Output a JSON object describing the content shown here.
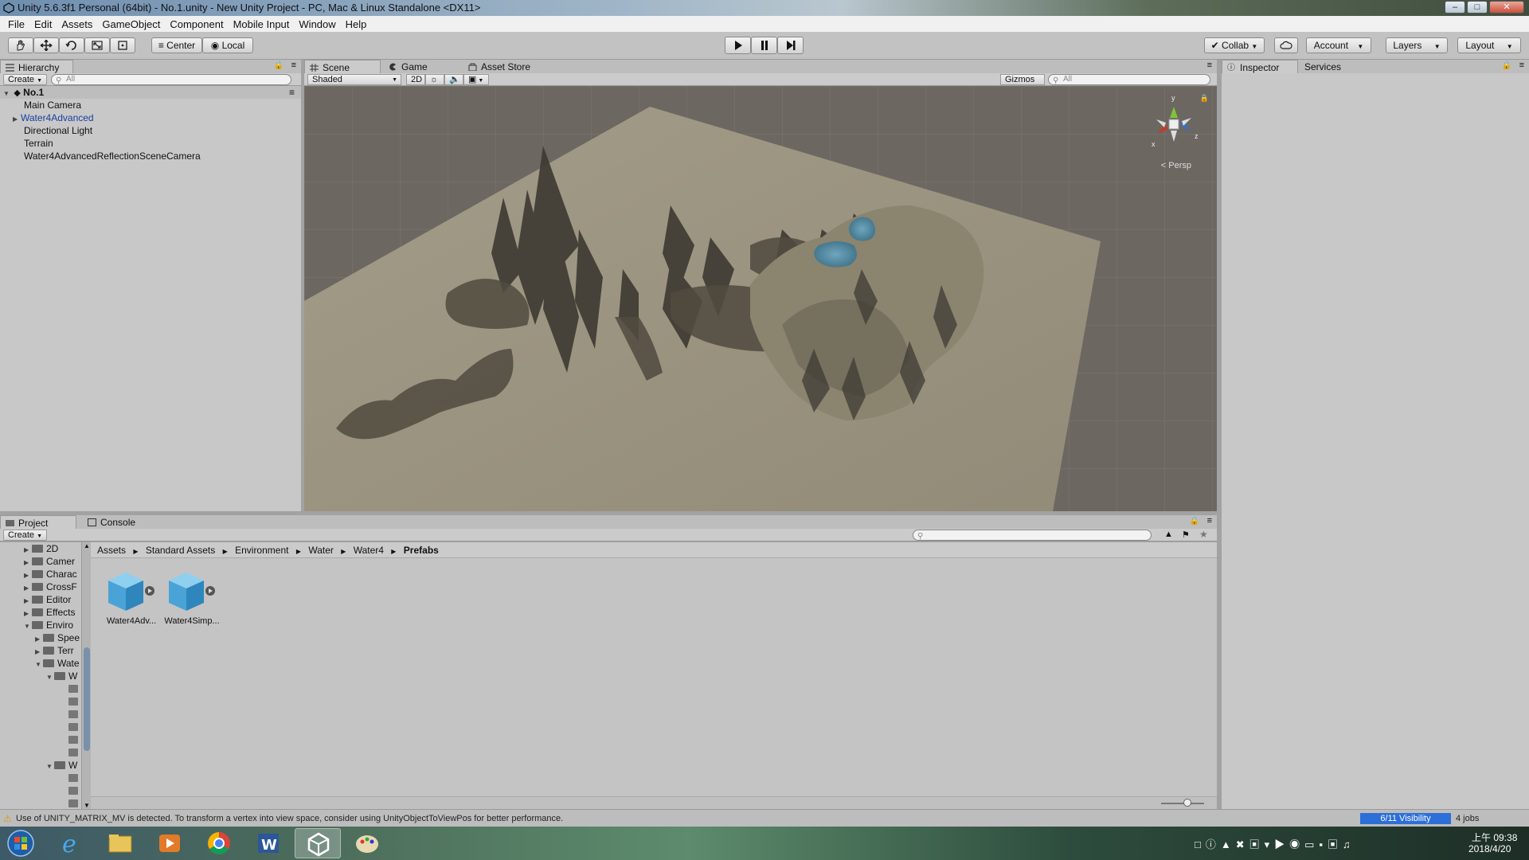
{
  "window": {
    "title": "Unity 5.6.3f1 Personal (64bit) - No.1.unity - New Unity Project - PC, Mac & Linux Standalone <DX11>",
    "controls": [
      "minimize-icon",
      "maximize-icon",
      "close-icon"
    ]
  },
  "menu": [
    "File",
    "Edit",
    "Assets",
    "GameObject",
    "Component",
    "Mobile Input",
    "Window",
    "Help"
  ],
  "toolbar": {
    "tools": [
      "hand-icon",
      "move-icon",
      "rotate-icon",
      "scale-icon",
      "rect-icon"
    ],
    "pivot_label": "Center",
    "space_label": "Local",
    "play_controls": [
      "play-icon",
      "pause-icon",
      "step-icon"
    ],
    "collab_label": "Collab",
    "account_label": "Account",
    "layers_label": "Layers",
    "layout_label": "Layout"
  },
  "hierarchy": {
    "tab": "Hierarchy",
    "create_label": "Create",
    "search_placeholder": "All",
    "scene_name": "No.1",
    "items": [
      {
        "label": "Main Camera"
      },
      {
        "label": "Water4Advanced",
        "color": "#1a3fa0"
      },
      {
        "label": "Directional Light"
      },
      {
        "label": "Terrain"
      },
      {
        "label": "Water4AdvancedReflectionSceneCamera"
      }
    ]
  },
  "scene": {
    "tabs": [
      "Scene",
      "Game",
      "Asset Store"
    ],
    "shading_mode": "Shaded",
    "mode_2d": "2D",
    "gizmos_label": "Gizmos",
    "search_placeholder": "All",
    "gizmo_axes": [
      "y",
      "x",
      "z"
    ],
    "projection_label": "Persp"
  },
  "inspector": {
    "tabs": [
      "Inspector",
      "Services"
    ]
  },
  "project": {
    "tabs": [
      "Project",
      "Console"
    ],
    "create_label": "Create",
    "breadcrumb": [
      "Assets",
      "Standard Assets",
      "Environment",
      "Water",
      "Water4",
      "Prefabs"
    ],
    "tree": [
      {
        "label": "2D",
        "indent": 0,
        "arrow": "▶"
      },
      {
        "label": "Camer",
        "indent": 0,
        "arrow": "▶"
      },
      {
        "label": "Charac",
        "indent": 0,
        "arrow": "▶"
      },
      {
        "label": "CrossF",
        "indent": 0,
        "arrow": "▶"
      },
      {
        "label": "Editor",
        "indent": 0,
        "arrow": "▶"
      },
      {
        "label": "Effects",
        "indent": 0,
        "arrow": "▶"
      },
      {
        "label": "Enviro",
        "indent": 0,
        "arrow": "▼"
      },
      {
        "label": "Spee",
        "indent": 1,
        "arrow": "▶"
      },
      {
        "label": "Terr",
        "indent": 1,
        "arrow": "▶"
      },
      {
        "label": "Wate",
        "indent": 1,
        "arrow": "▼"
      },
      {
        "label": "W",
        "indent": 2,
        "arrow": "▼"
      }
    ],
    "assets": [
      {
        "label": "Water4Adv..."
      },
      {
        "label": "Water4Simp..."
      }
    ]
  },
  "status": {
    "message": "Use of UNITY_MATRIX_MV is detected. To transform a vertex into view space, consider using UnityObjectToViewPos for better performance.",
    "visibility": "6/11 Visibility",
    "jobs": "4 jobs"
  },
  "taskbar": {
    "apps": [
      "windows-start-icon",
      "internet-explorer-icon",
      "file-explorer-icon",
      "media-player-icon",
      "chrome-icon",
      "word-icon",
      "unity-icon",
      "paint-icon"
    ],
    "time": "上午 09:38",
    "date": "2018/4/20"
  }
}
